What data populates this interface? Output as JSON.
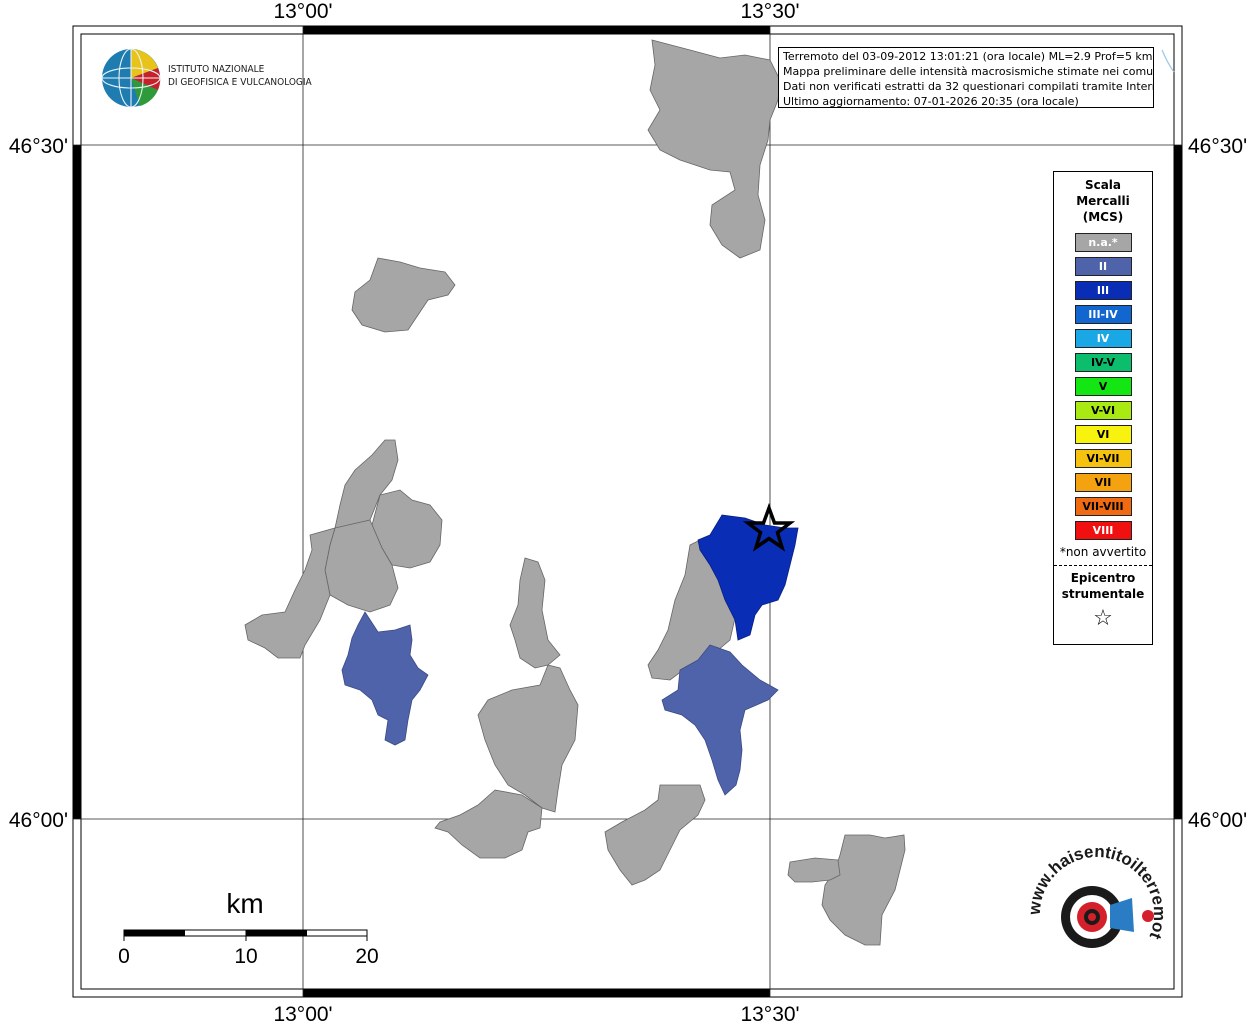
{
  "map": {
    "coordinates": {
      "top_lon": [
        "13°00'",
        "13°30'"
      ],
      "bottom_lon": [
        "13°00'",
        "13°30'"
      ],
      "left_lat": [
        "46°30'",
        "46°00'"
      ],
      "right_lat": [
        "46°30'",
        "46°00'"
      ]
    },
    "logo_ingv": {
      "line1": "ISTITUTO NAZIONALE",
      "line2": "DI GEOFISICA E VULCANOLOGIA"
    },
    "info": {
      "line1": "Terremoto del 03-09-2012 13:01:21 (ora locale) ML=2.9 Prof=5 km",
      "line2": "Mappa preliminare delle intensità macrosismiche stimate nei comuni",
      "line3": "Dati non verificati estratti da 32 questionari compilati tramite Internet.",
      "line4": "Ultimo aggiornamento: 07-01-2026 20:35 (ora locale)"
    },
    "legend": {
      "title_line1": "Scala",
      "title_line2": "Mercalli",
      "title_line3": "(MCS)",
      "items": [
        {
          "label": "n.a.*",
          "color": "#a6a6a6",
          "text_color": "#ffffff"
        },
        {
          "label": "II",
          "color": "#4f63aa",
          "text_color": "#ffffff"
        },
        {
          "label": "III",
          "color": "#0a2db5",
          "text_color": "#ffffff"
        },
        {
          "label": "III-IV",
          "color": "#1266d0",
          "text_color": "#ffffff"
        },
        {
          "label": "IV",
          "color": "#19a7e6",
          "text_color": "#ffffff"
        },
        {
          "label": "IV-V",
          "color": "#0cbd6b",
          "text_color": "#000000"
        },
        {
          "label": "V",
          "color": "#14e614",
          "text_color": "#000000"
        },
        {
          "label": "V-VI",
          "color": "#a9ea12",
          "text_color": "#000000"
        },
        {
          "label": "VI",
          "color": "#f7f20e",
          "text_color": "#000000"
        },
        {
          "label": "VI-VII",
          "color": "#f5c20f",
          "text_color": "#000000"
        },
        {
          "label": "VII",
          "color": "#f5a210",
          "text_color": "#000000"
        },
        {
          "label": "VII-VIII",
          "color": "#f06a12",
          "text_color": "#000000"
        },
        {
          "label": "VIII",
          "color": "#f01010",
          "text_color": "#ffffff"
        }
      ],
      "note": "*non avvertito",
      "epicenter_line1": "Epicentro",
      "epicenter_line2": "strumentale",
      "epicenter_symbol": "☆"
    },
    "scale_bar": {
      "unit": "km",
      "labels": [
        "0",
        "10",
        "20"
      ]
    },
    "logo_hsit": {
      "text": "www.haisentitoilterremoto.it"
    },
    "colors": {
      "not_felt": "#a6a6a6",
      "intensity_II": "#4f63aa",
      "intensity_III": "#0a2db5"
    }
  }
}
